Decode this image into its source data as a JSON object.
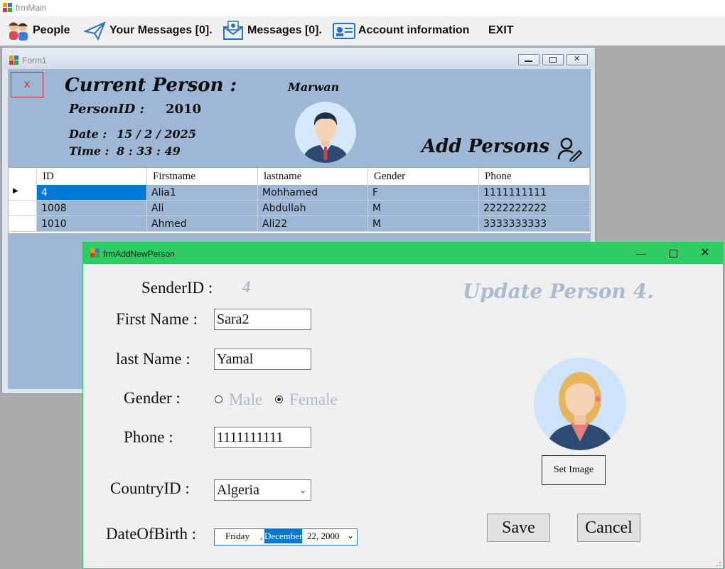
{
  "main_window": {
    "title": "frmMain",
    "menu": [
      {
        "label": "People",
        "icon": "people-icon"
      },
      {
        "label": "Your Messages [0].",
        "icon": "paper-plane-icon"
      },
      {
        "label": "Messages [0].",
        "icon": "mail-icon"
      },
      {
        "label": "Account information",
        "icon": "id-card-icon"
      },
      {
        "label": "EXIT"
      }
    ]
  },
  "form1": {
    "title": "Form1",
    "close_label": "x",
    "current_person_label": "Current Person :",
    "person_id_label": "PersonID :",
    "person_id_value": "2010",
    "username": "Marwan",
    "date_label": "Date :",
    "date_value": "15 / 2 / 2025",
    "time_label": "Time :",
    "time_value": "8 : 33 : 49",
    "add_persons_label": "Add Persons",
    "grid": {
      "columns": [
        "ID",
        "Firstname",
        "lastname",
        "Gender",
        "Phone"
      ],
      "rows": [
        {
          "ID": "4",
          "Firstname": "Alia1",
          "lastname": "Mohhamed",
          "Gender": "F",
          "Phone": "1111111111",
          "selected": true
        },
        {
          "ID": "1008",
          "Firstname": "Ali",
          "lastname": "Abdullah",
          "Gender": "M",
          "Phone": "2222222222"
        },
        {
          "ID": "1010",
          "Firstname": "Ahmed",
          "lastname": "Ali22",
          "Gender": "M",
          "Phone": "3333333333"
        }
      ]
    }
  },
  "dialog": {
    "title": "frmAddNewPerson",
    "heading": "Update Person 4.",
    "sender_id_label": "SenderID :",
    "sender_id_value": "4",
    "first_name_label": "First Name :",
    "first_name_value": "Sara2",
    "last_name_label": "last Name :",
    "last_name_value": "Yamal",
    "gender_label": "Gender :",
    "gender_options": [
      "Male",
      "Female"
    ],
    "gender_selected": "Female",
    "phone_label": "Phone :",
    "phone_value": "1111111111",
    "country_label": "CountryID :",
    "country_value": "Algeria",
    "dob_label": "DateOfBirth :",
    "dob_day": "Friday",
    "dob_sep": ",",
    "dob_month": "December",
    "dob_rest": "22, 2000",
    "set_image_label": "Set Image",
    "save_label": "Save",
    "cancel_label": "Cancel"
  },
  "colors": {
    "dialog_title_bar": "#2ecc62",
    "form1_body": "#9db7d4",
    "selection": "#0078d7",
    "heading_text": "#a9bccf"
  }
}
